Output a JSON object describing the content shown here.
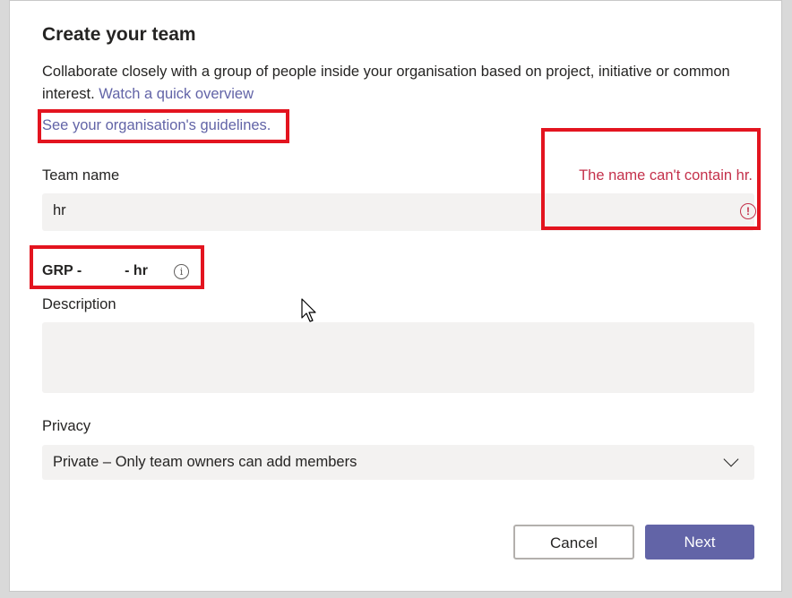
{
  "dialog": {
    "title": "Create your team",
    "intro_text": "Collaborate closely with a group of people inside your organisation based on project, initiative or common interest.",
    "overview_link": "Watch a quick overview",
    "guidelines_link": "See your organisation's guidelines.",
    "team_name": {
      "label": "Team name",
      "value": "hr",
      "error": "The name can't contain hr."
    },
    "group_name": {
      "prefix": "GRP -",
      "suffix": "- hr"
    },
    "description": {
      "label": "Description",
      "value": ""
    },
    "privacy": {
      "label": "Privacy",
      "selected": "Private – Only team owners can add members"
    },
    "buttons": {
      "cancel": "Cancel",
      "next": "Next"
    }
  },
  "colors": {
    "accent": "#6264a7",
    "error": "#c4314b",
    "highlight": "#e3141f",
    "input_bg": "#f3f2f1"
  },
  "icons": {
    "error": "error-circle-icon",
    "info": "info-icon",
    "dropdown": "chevron-down-icon",
    "pointer": "mouse-cursor-icon"
  }
}
